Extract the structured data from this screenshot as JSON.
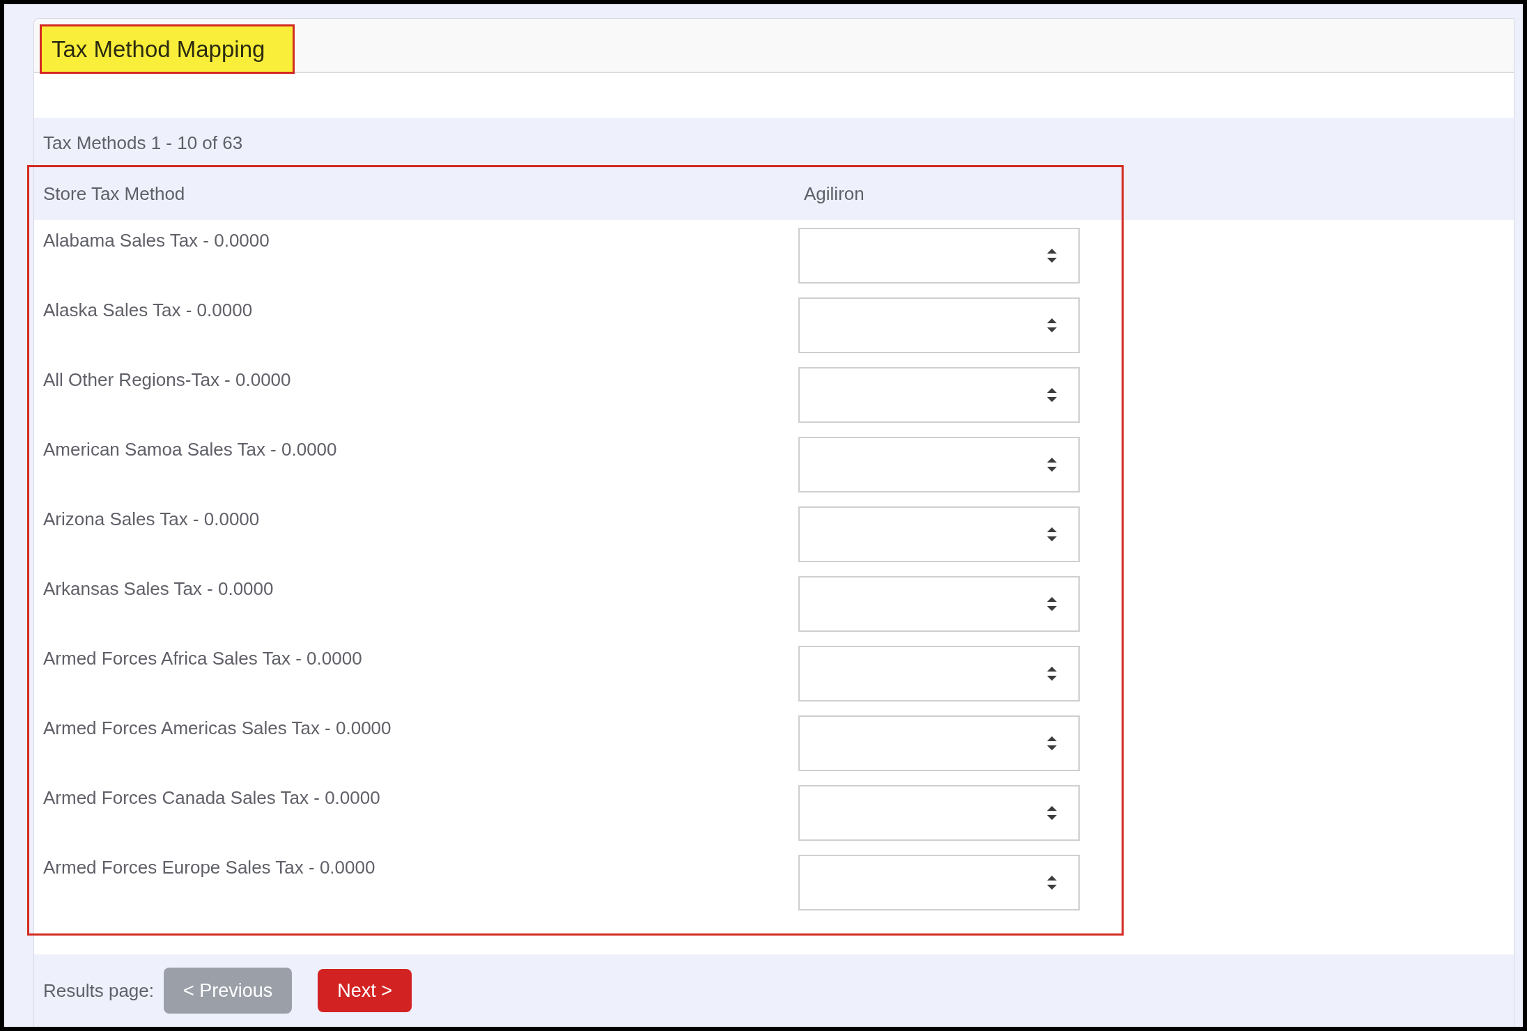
{
  "header": {
    "title": "Tax Method Mapping"
  },
  "count_label": "Tax Methods 1 - 10 of 63",
  "table": {
    "columns": [
      "Store Tax Method",
      "Agiliron"
    ],
    "rows": [
      {
        "name": "Alabama Sales Tax - 0.0000"
      },
      {
        "name": "Alaska Sales Tax - 0.0000"
      },
      {
        "name": "All Other Regions-Tax - 0.0000"
      },
      {
        "name": "American Samoa Sales Tax - 0.0000"
      },
      {
        "name": "Arizona Sales Tax - 0.0000"
      },
      {
        "name": "Arkansas Sales Tax - 0.0000"
      },
      {
        "name": "Armed Forces Africa Sales Tax - 0.0000"
      },
      {
        "name": "Armed Forces Americas Sales Tax - 0.0000"
      },
      {
        "name": "Armed Forces Canada Sales Tax - 0.0000"
      },
      {
        "name": "Armed Forces Europe Sales Tax - 0.0000"
      }
    ]
  },
  "pagination": {
    "label": "Results page:",
    "buttons": [
      {
        "label": "< Previous",
        "disabled": true
      },
      {
        "label": "Next >",
        "disabled": false
      }
    ]
  }
}
